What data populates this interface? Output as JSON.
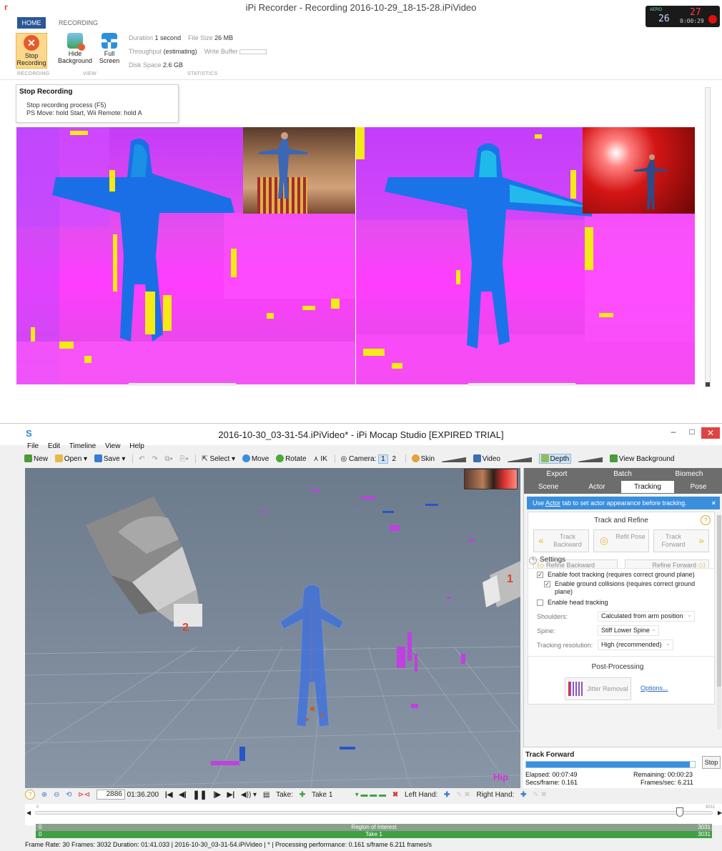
{
  "recorder": {
    "title": "iPi Recorder - Recording 2016-10-29_18-15-28.iPiVideo",
    "logo": "r",
    "tabs": [
      "HOME",
      "RECORDING"
    ],
    "counter": {
      "aero": "AERO",
      "frames_top": "27",
      "frames_bottom": "26",
      "time": "0:00:29"
    },
    "buttons": {
      "stop": "Stop Recording",
      "hide_background": "Hide Background",
      "full_screen": "Full Screen"
    },
    "group_labels": {
      "recording": "RECORDING",
      "view": "VIEW",
      "statistics": "STATISTICS"
    },
    "stats": {
      "duration_label": "Duration",
      "duration_value": "1 second",
      "file_size_label": "File Size",
      "file_size_value": "26 MB",
      "throughput_label": "Throughput",
      "throughput_value": "(estimating)",
      "write_buffer_label": "Write Buffer",
      "disk_space_label": "Disk Space",
      "disk_space_value": "2.6 GB"
    },
    "tooltip": {
      "title": "Stop Recording",
      "line1": "Stop recording process (F5)",
      "line2": "PS Move: hold Start, Wii Remote: hold A"
    }
  },
  "studio": {
    "logo": "S",
    "title": "2016-10-30_03-31-54.iPiVideo* - iPi Mocap Studio [EXPIRED TRIAL]",
    "window_buttons": {
      "min": "–",
      "max": "□",
      "close": "✕"
    },
    "menu": [
      "File",
      "Edit",
      "Timeline",
      "View",
      "Help"
    ],
    "toolbar": {
      "new": "New",
      "open": "Open",
      "save": "Save",
      "select": "Select",
      "move": "Move",
      "rotate": "Rotate",
      "ik": "IK",
      "camera_label": "Camera:",
      "camera_1": "1",
      "camera_2": "2",
      "skin": "Skin",
      "video": "Video",
      "depth": "Depth",
      "view_background": "View Background"
    },
    "viewport": {
      "camera1_label": "1",
      "camera2_label": "2",
      "hip_label": "Hip"
    },
    "panel": {
      "tabs_row1": [
        "Export",
        "Batch",
        "Biomech"
      ],
      "tabs_row2": [
        "Scene",
        "Actor",
        "Tracking",
        "Pose"
      ],
      "info_prefix": "Use ",
      "info_link": "Actor",
      "info_suffix": " tab to set actor appearance before tracking.",
      "info_close": "×",
      "track_refine_header": "Track and Refine",
      "help": "?",
      "track_backward": "Track Backward",
      "refit_pose": "Refit Pose",
      "track_forward": "Track Forward",
      "refine_backward": "Refine Backward",
      "refine_forward": "Refine Forward",
      "settings_header": "Settings",
      "opt_foot": "Enable foot tracking (requires correct ground plane)",
      "opt_ground": "Enable ground collisions (requires correct ground plane)",
      "opt_head": "Enable head tracking",
      "shoulders_label": "Shoulders:",
      "shoulders_value": "Calculated from arm position",
      "spine_label": "Spine:",
      "spine_value": "Stiff Lower Spine",
      "resolution_label": "Tracking resolution:",
      "resolution_value": "High (recommended)",
      "post_processing_header": "Post-Processing",
      "jitter_removal": "Jitter Removal",
      "options_link": "Options..."
    },
    "track_forward_status": {
      "header": "Track Forward",
      "progress": 0.97,
      "elapsed": "Elapsed: 00:07:49",
      "remaining": "Remaining: 00:00:23",
      "secs_per_frame": "Secs/frame: 0.161",
      "frames_per_sec": "Frames/sec: 6.211",
      "stop": "Stop"
    },
    "timeline": {
      "current_frame": "2886",
      "current_time": "01:36.200",
      "take_label": "Take:",
      "take_name": "Take 1",
      "left_hand": "Left Hand:",
      "right_hand": "Right Hand:",
      "min": "0",
      "max": "3031",
      "playhead": 0.952,
      "roi_label": "Region of Interest",
      "roi_start": "0",
      "roi_end": "3031",
      "take_bar_label": "Take 1",
      "take_start": "0",
      "take_end": "3031"
    },
    "status_bar": "Frame Rate: 30  Frames: 3032  Duration: 01:41.033  |  2016-10-30_03-31-54.iPiVideo  |  *  |  Processing performance: 0.161 s/frame 6.211 frames/s"
  }
}
